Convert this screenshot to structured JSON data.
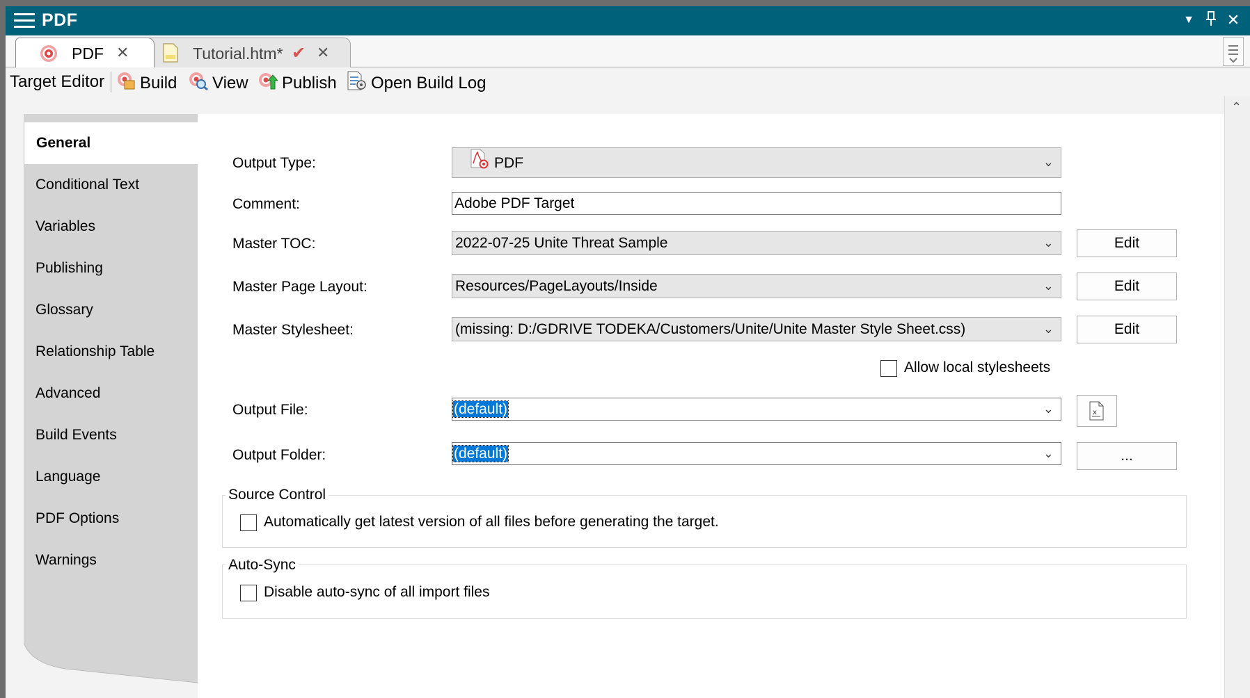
{
  "window": {
    "title": "PDF",
    "controls": [
      "▼",
      "🖈",
      "✕"
    ]
  },
  "tabs": [
    {
      "label": "PDF",
      "close": "✕",
      "icon": "target-icon"
    },
    {
      "label": "Tutorial.htm*",
      "check": "✔",
      "close": "✕",
      "icon": "document-icon"
    }
  ],
  "toolbar": {
    "target_editor": "Target Editor",
    "build": "Build",
    "view": "View",
    "publish": "Publish",
    "open_build_log": "Open Build Log"
  },
  "nav": {
    "items": [
      "General",
      "Conditional Text",
      "Variables",
      "Publishing",
      "Glossary",
      "Relationship Table",
      "Advanced",
      "Build Events",
      "Language",
      "PDF Options",
      "Warnings"
    ]
  },
  "form": {
    "output_type_label": "Output Type:",
    "output_type_value": "PDF",
    "comment_label": "Comment:",
    "comment_value": "Adobe PDF Target",
    "master_toc_label": "Master TOC:",
    "master_toc_value": "2022-07-25 Unite Threat Sample",
    "master_page_layout_label": "Master Page Layout:",
    "master_page_layout_value": "Resources/PageLayouts/Inside",
    "master_stylesheet_label": "Master Stylesheet:",
    "master_stylesheet_value": "(missing: D:/GDRIVE TODEKA/Customers/Unite/Unite Master Style Sheet.css)",
    "edit_label": "Edit",
    "allow_local_stylesheets": "Allow local stylesheets",
    "output_file_label": "Output File:",
    "output_file_value": "(default)",
    "output_folder_label": "Output Folder:",
    "output_folder_value": "(default)",
    "browse_label": "..."
  },
  "source_control": {
    "title": "Source Control",
    "option": "Automatically get latest version of all files before generating the target."
  },
  "auto_sync": {
    "title": "Auto-Sync",
    "option": "Disable auto-sync of all import files"
  },
  "colors": {
    "titlebar": "#00617b",
    "selection": "#0078d7",
    "panel": "#d4d4d4"
  }
}
